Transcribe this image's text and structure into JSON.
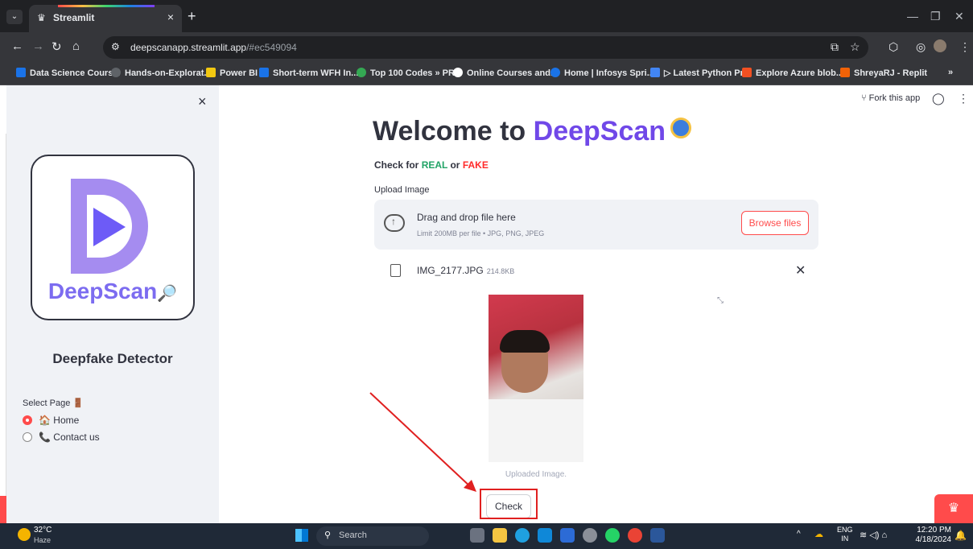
{
  "browser": {
    "tab_title": "Streamlit",
    "tab_close": "×",
    "new_tab": "+",
    "tab_search": "⌄",
    "url_host": "deepscanapp.streamlit.app",
    "url_path": "/#ec549094",
    "window_controls": {
      "minimize": "—",
      "restore": "❐",
      "close": "✕"
    }
  },
  "bookmarks": [
    {
      "label": "Data Science Cours...",
      "color": "#1a73e8"
    },
    {
      "label": "Hands-on-Explorat...",
      "color": "#5f6368"
    },
    {
      "label": "Power BI",
      "color": "#f2c811"
    },
    {
      "label": "Short-term WFH In...",
      "color": "#1a73e8"
    },
    {
      "label": "Top 100 Codes » PR...",
      "color": "#34a853"
    },
    {
      "label": "Online Courses and...",
      "color": "#ffffff"
    },
    {
      "label": "Home | Infosys Spri...",
      "color": "#1a73e8"
    },
    {
      "label": "▷ Latest Python Pr...",
      "color": "#4285f4"
    },
    {
      "label": "Explore Azure blob...",
      "color": "#f25022"
    },
    {
      "label": "ShreyaRJ - Replit",
      "color": "#f26207"
    }
  ],
  "bookmarks_overflow": "»",
  "sidebar": {
    "close": "×",
    "logo_text": "DeepScan",
    "title": "Deepfake Detector",
    "select_label": "Select Page",
    "options": [
      {
        "label": "Home",
        "icon": "🏠",
        "selected": true
      },
      {
        "label": "Contact us",
        "icon": "📞",
        "selected": false
      }
    ]
  },
  "header": {
    "fork": "Fork this app",
    "github_icon": "github-icon",
    "menu": "⋮"
  },
  "main": {
    "title_prefix": "Welcome to ",
    "title_brand": "DeepScan",
    "check_for": "Check for ",
    "real": "REAL",
    "or": " or ",
    "fake": "FAKE",
    "upload_label": "Upload Image",
    "drop_title": "Drag and drop file here",
    "drop_limit": "Limit 200MB per file • JPG, PNG, JPEG",
    "browse": "Browse files",
    "file_name": "IMG_2177.JPG",
    "file_size": "214.8KB",
    "file_remove": "✕",
    "fullscreen": "⤡",
    "caption": "Uploaded Image.",
    "check_button": "Check"
  },
  "taskbar": {
    "temp": "32°C",
    "weather": "Haze",
    "search": "Search",
    "lang_top": "ENG",
    "lang_bottom": "IN",
    "time": "12:20 PM",
    "date": "4/18/2024",
    "tray_up": "^",
    "sys_icons": "≋ ◁) ⌂"
  },
  "colors": {
    "accent": "#ff4b4b",
    "brand": "#7048e8",
    "real": "#21a366",
    "fake": "#ff2b2b",
    "annotation": "#e02020"
  }
}
